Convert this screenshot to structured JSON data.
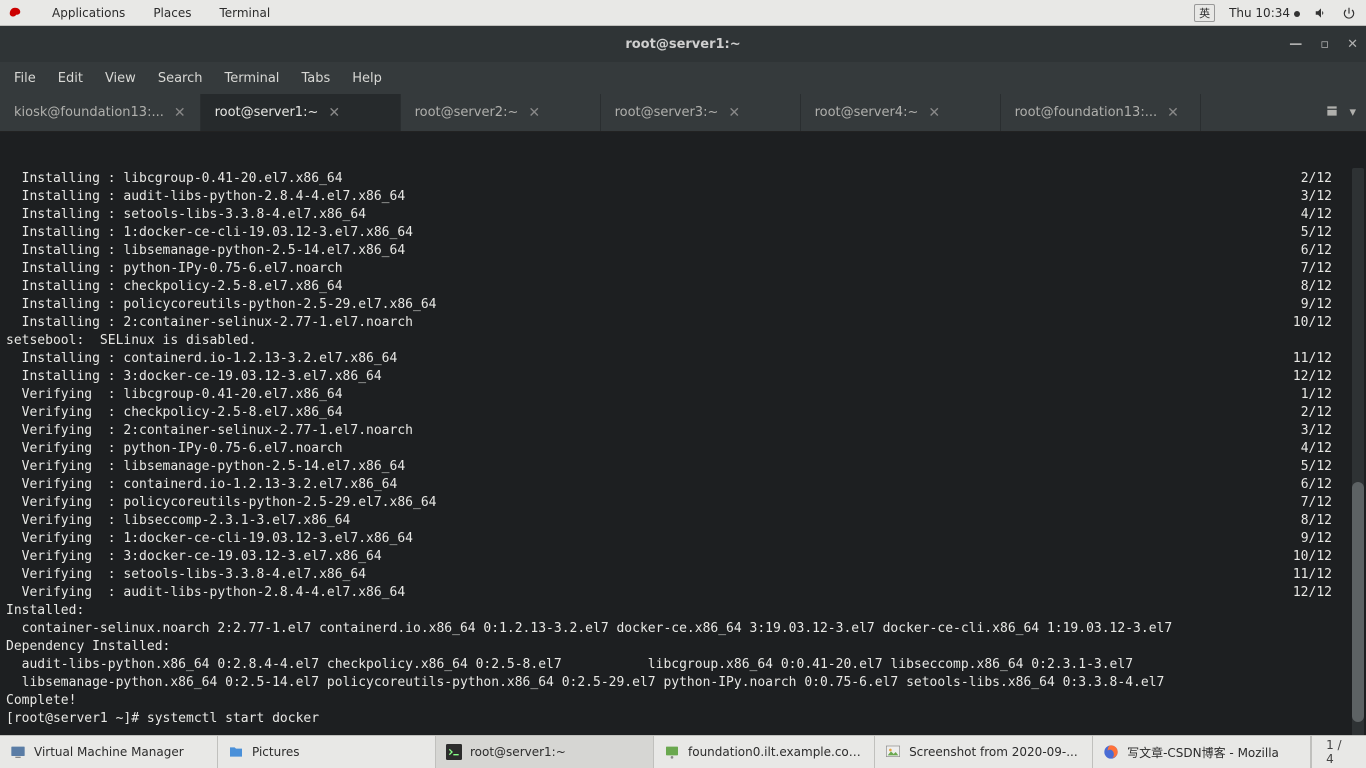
{
  "top_panel": {
    "apps": "Applications",
    "places": "Places",
    "terminal": "Terminal",
    "ime": "英",
    "clock": "Thu 10:34"
  },
  "window": {
    "title": "root@server1:~"
  },
  "menubar": [
    "File",
    "Edit",
    "View",
    "Search",
    "Terminal",
    "Tabs",
    "Help"
  ],
  "tabs": [
    {
      "label": "kiosk@foundation13:...",
      "active": false
    },
    {
      "label": "root@server1:~",
      "active": true
    },
    {
      "label": "root@server2:~",
      "active": false
    },
    {
      "label": "root@server3:~",
      "active": false
    },
    {
      "label": "root@server4:~",
      "active": false
    },
    {
      "label": "root@foundation13:...",
      "active": false
    }
  ],
  "terminal_lines": [
    {
      "l": "  Installing : libcgroup-0.41-20.el7.x86_64",
      "r": "2/12"
    },
    {
      "l": "  Installing : audit-libs-python-2.8.4-4.el7.x86_64",
      "r": "3/12"
    },
    {
      "l": "  Installing : setools-libs-3.3.8-4.el7.x86_64",
      "r": "4/12"
    },
    {
      "l": "  Installing : 1:docker-ce-cli-19.03.12-3.el7.x86_64",
      "r": "5/12"
    },
    {
      "l": "  Installing : libsemanage-python-2.5-14.el7.x86_64",
      "r": "6/12"
    },
    {
      "l": "  Installing : python-IPy-0.75-6.el7.noarch",
      "r": "7/12"
    },
    {
      "l": "  Installing : checkpolicy-2.5-8.el7.x86_64",
      "r": "8/12"
    },
    {
      "l": "  Installing : policycoreutils-python-2.5-29.el7.x86_64",
      "r": "9/12"
    },
    {
      "l": "  Installing : 2:container-selinux-2.77-1.el7.noarch",
      "r": "10/12"
    },
    {
      "l": "setsebool:  SELinux is disabled.",
      "r": ""
    },
    {
      "l": "  Installing : containerd.io-1.2.13-3.2.el7.x86_64",
      "r": "11/12"
    },
    {
      "l": "  Installing : 3:docker-ce-19.03.12-3.el7.x86_64",
      "r": "12/12"
    },
    {
      "l": "  Verifying  : libcgroup-0.41-20.el7.x86_64",
      "r": "1/12"
    },
    {
      "l": "  Verifying  : checkpolicy-2.5-8.el7.x86_64",
      "r": "2/12"
    },
    {
      "l": "  Verifying  : 2:container-selinux-2.77-1.el7.noarch",
      "r": "3/12"
    },
    {
      "l": "  Verifying  : python-IPy-0.75-6.el7.noarch",
      "r": "4/12"
    },
    {
      "l": "  Verifying  : libsemanage-python-2.5-14.el7.x86_64",
      "r": "5/12"
    },
    {
      "l": "  Verifying  : containerd.io-1.2.13-3.2.el7.x86_64",
      "r": "6/12"
    },
    {
      "l": "  Verifying  : policycoreutils-python-2.5-29.el7.x86_64",
      "r": "7/12"
    },
    {
      "l": "  Verifying  : libseccomp-2.3.1-3.el7.x86_64",
      "r": "8/12"
    },
    {
      "l": "  Verifying  : 1:docker-ce-cli-19.03.12-3.el7.x86_64",
      "r": "9/12"
    },
    {
      "l": "  Verifying  : 3:docker-ce-19.03.12-3.el7.x86_64",
      "r": "10/12"
    },
    {
      "l": "  Verifying  : setools-libs-3.3.8-4.el7.x86_64",
      "r": "11/12"
    },
    {
      "l": "  Verifying  : audit-libs-python-2.8.4-4.el7.x86_64",
      "r": "12/12"
    },
    {
      "l": "",
      "r": ""
    },
    {
      "l": "Installed:",
      "r": ""
    },
    {
      "l": "  container-selinux.noarch 2:2.77-1.el7 containerd.io.x86_64 0:1.2.13-3.2.el7 docker-ce.x86_64 3:19.03.12-3.el7 docker-ce-cli.x86_64 1:19.03.12-3.el7",
      "r": ""
    },
    {
      "l": "",
      "r": ""
    },
    {
      "l": "Dependency Installed:",
      "r": ""
    },
    {
      "l": "  audit-libs-python.x86_64 0:2.8.4-4.el7 checkpolicy.x86_64 0:2.5-8.el7           libcgroup.x86_64 0:0.41-20.el7 libseccomp.x86_64 0:2.3.1-3.el7",
      "r": ""
    },
    {
      "l": "  libsemanage-python.x86_64 0:2.5-14.el7 policycoreutils-python.x86_64 0:2.5-29.el7 python-IPy.noarch 0:0.75-6.el7 setools-libs.x86_64 0:3.3.8-4.el7",
      "r": ""
    },
    {
      "l": "",
      "r": ""
    },
    {
      "l": "Complete!",
      "r": ""
    },
    {
      "l": "[root@server1 ~]# systemctl start docker",
      "r": ""
    }
  ],
  "taskbar": [
    {
      "label": "Virtual Machine Manager",
      "icon": "vm"
    },
    {
      "label": "Pictures",
      "icon": "folder"
    },
    {
      "label": "root@server1:~",
      "icon": "terminal",
      "active": true
    },
    {
      "label": "foundation0.ilt.example.com...",
      "icon": "remote"
    },
    {
      "label": "Screenshot from 2020-09-...",
      "icon": "image"
    },
    {
      "label": "写文章-CSDN博客 - Mozilla",
      "icon": "firefox"
    }
  ],
  "workspace": "1 / 4"
}
